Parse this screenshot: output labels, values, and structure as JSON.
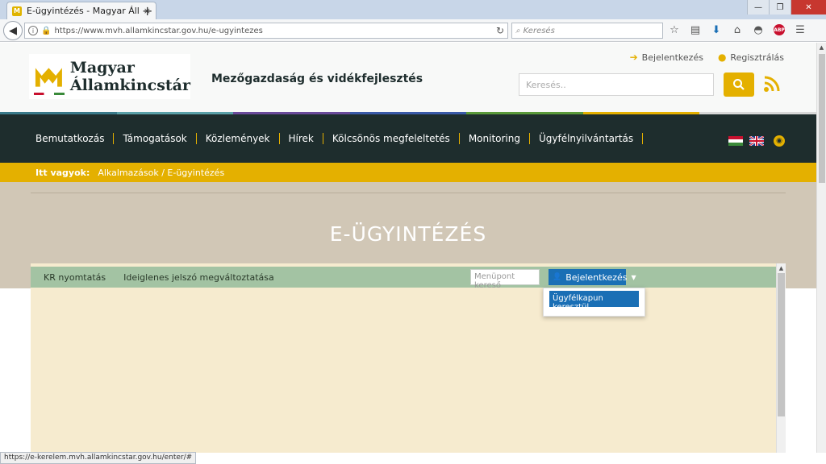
{
  "browser": {
    "tab_title": "E-ügyintézés - Magyar Álla...",
    "tab_close": "×",
    "new_tab": "+",
    "win_minimize": "—",
    "win_maximize": "❐",
    "win_close": "✕",
    "url": "https://www.mvh.allamkincstar.gov.hu/e-ugyintezes",
    "search_placeholder": "Keresés",
    "status_url": "https://e-kerelem.mvh.allamkincstar.gov.hu/enter/#"
  },
  "header": {
    "logo_line1": "Magyar",
    "logo_line2": "Államkincstár",
    "site_title": "Mezőgazdaság és vidékfejlesztés",
    "login_link": "Bejelentkezés",
    "register_link": "Regisztrálás",
    "search_placeholder": "Keresés.."
  },
  "nav": {
    "items": [
      "Bemutatkozás",
      "Támogatások",
      "Közlemények",
      "Hírek",
      "Kölcsönös megfeleltetés",
      "Monitoring",
      "Ügyfélnyilvántartás"
    ]
  },
  "breadcrumb": {
    "lead": "Itt vagyok:",
    "path": "Alkalmazások / E-ügyintézés"
  },
  "hero": {
    "title": "E-ÜGYINTÉZÉS"
  },
  "app": {
    "links": [
      "KR nyomtatás",
      "Ideiglenes jelszó megváltoztatása"
    ],
    "menu_search_placeholder": "Menüpont kereső",
    "login_button": "Bejelentkezés",
    "dropdown_item": "Ügyfélkapun keresztül"
  },
  "colors": {
    "brand_dark": "#1e2d2d",
    "brand_yellow": "#e4b000",
    "app_blue": "#1a6fb5",
    "app_green": "#a3c3a3"
  }
}
